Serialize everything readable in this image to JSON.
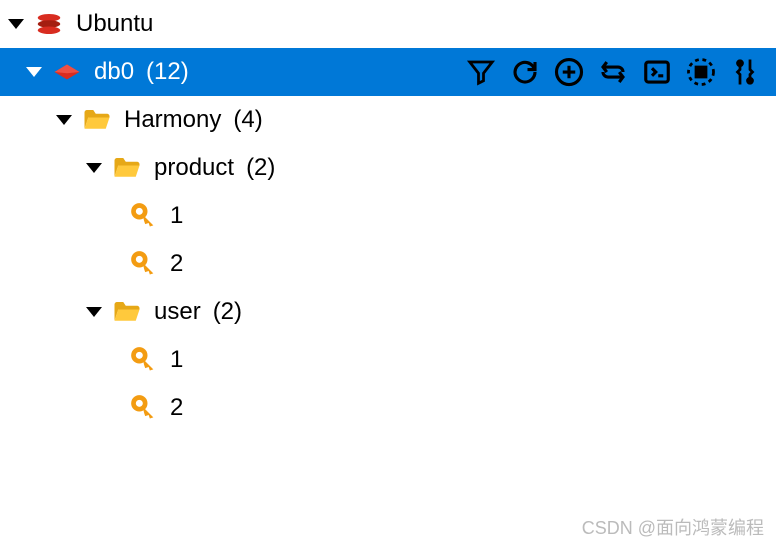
{
  "root": {
    "label": "Ubuntu"
  },
  "database": {
    "label": "db0",
    "count": "(12)",
    "toolbar": {
      "filter": "Filter",
      "refresh": "Refresh",
      "add": "Add Key",
      "reload": "Reload",
      "console": "Console",
      "analyze": "Analyze",
      "tools": "Tools"
    }
  },
  "namespaces": [
    {
      "label": "Harmony",
      "count": "(4)",
      "folders": [
        {
          "label": "product",
          "count": "(2)",
          "keys": [
            "1",
            "2"
          ]
        },
        {
          "label": "user",
          "count": "(2)",
          "keys": [
            "1",
            "2"
          ]
        }
      ]
    }
  ],
  "watermark": "CSDN @面向鸿蒙编程"
}
